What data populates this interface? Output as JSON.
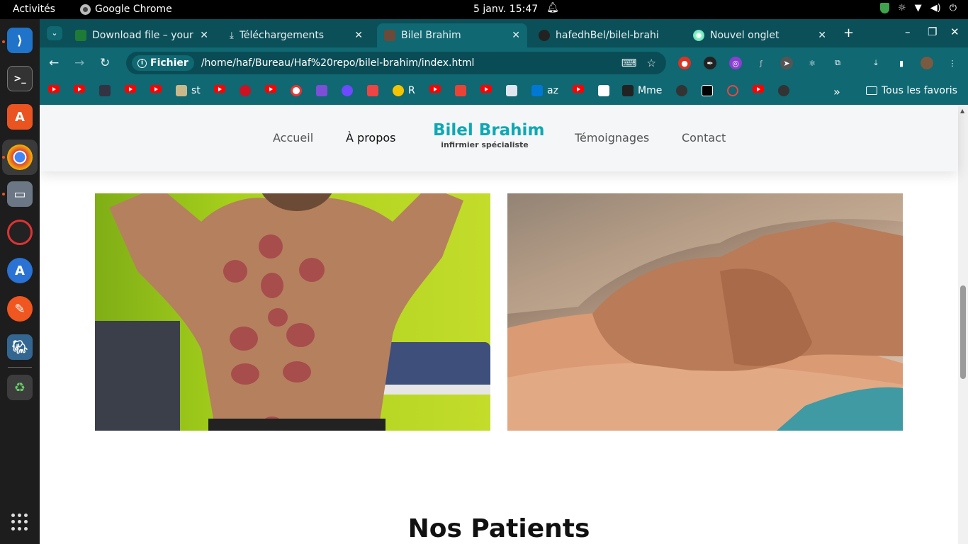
{
  "system": {
    "activities": "Activités",
    "app_name": "Google Chrome",
    "clock": "5 janv.  15:47"
  },
  "tabs": [
    {
      "title": "Download file – your c",
      "favicon_color": "#1e7b36"
    },
    {
      "title": "Téléchargements",
      "favicon_color": "#0f6872"
    },
    {
      "title": "Bilel Brahim",
      "favicon_color": "#6b4a3a",
      "active": true
    },
    {
      "title": "hafedhBel/bilel-brahi",
      "favicon_color": "#222222"
    },
    {
      "title": "Nouvel onglet",
      "favicon_color": "#0f6872"
    }
  ],
  "toolbar": {
    "chip_label": "Fichier",
    "url": "/home/haf/Bureau/Haf%20repo/bilel-brahim/index.html"
  },
  "bookmarks": {
    "labels": [
      "st",
      "R",
      "az",
      "Mme"
    ],
    "overflow": "»",
    "all_bookmarks": "Tous les favoris"
  },
  "site": {
    "nav": {
      "home": "Accueil",
      "about": "À propos",
      "testimonials": "Témoignages",
      "contact": "Contact"
    },
    "brand": {
      "name": "Bilel Brahim",
      "tagline": "infirmier spécialiste"
    },
    "section_title": "Nos Patients"
  },
  "colors": {
    "chrome_theme": "#0f6872",
    "brand_accent": "#0ea8b4"
  }
}
